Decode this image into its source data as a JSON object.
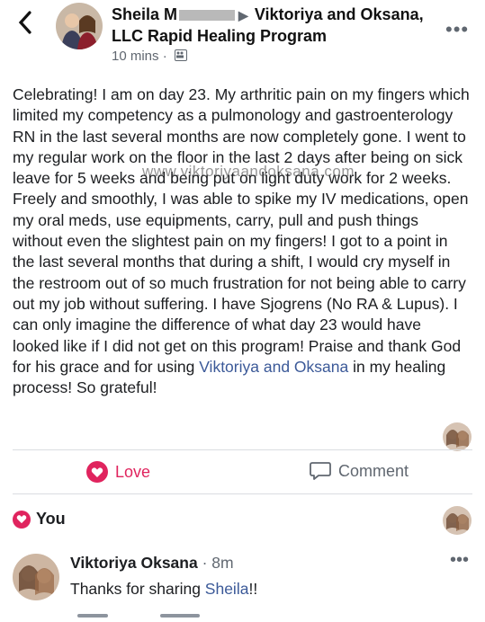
{
  "header": {
    "back_icon": "chevron-left-icon",
    "author": "Sheila M",
    "group": "Viktoriya and Oksana, LLC Rapid Healing Program",
    "time": "10 mins",
    "separator": "·",
    "audience_icon": "group-icon",
    "more_icon": "more-horizontal-icon",
    "more_glyph": "•••"
  },
  "post": {
    "text_before_link": "Celebrating! I am on day 23. My arthritic pain on my fingers which  limited my competency as a pulmonology and gastroenterology RN in the last several months are now completely gone. I went to my regular work on the floor in the last 2 days after being on sick leave for 5 weeks and being put on light duty work for 2 weeks. Freely and smoothly, I was able to spike my IV medications, open my oral meds, use equipments, carry, pull and push things without even the slightest pain on my fingers! I got to a point in the last several months that during a shift, I would cry myself in the restroom out of so much frustration for not being able to carry out my job without suffering. I have Sjogrens (No RA & Lupus). I can only imagine the difference of what day 23 would have looked like if I did not get on this program! Praise and thank God for his grace and for using ",
    "link_text": "Viktoriya and Oksana",
    "text_after_link": " in my healing process! So grateful!",
    "watermark": "www.viktoriyaandoksana.com"
  },
  "actions": {
    "love_label": "Love",
    "comment_label": "Comment"
  },
  "reactions": {
    "label": "You"
  },
  "comment": {
    "author": "Viktoriya Oksana",
    "time": " · 8m",
    "text_before": "Thanks for sharing ",
    "mention": "Sheila",
    "text_after": "!!",
    "more_glyph": "•••"
  },
  "colors": {
    "love": "#e0245e",
    "link": "#3b5998",
    "muted": "#606770"
  }
}
